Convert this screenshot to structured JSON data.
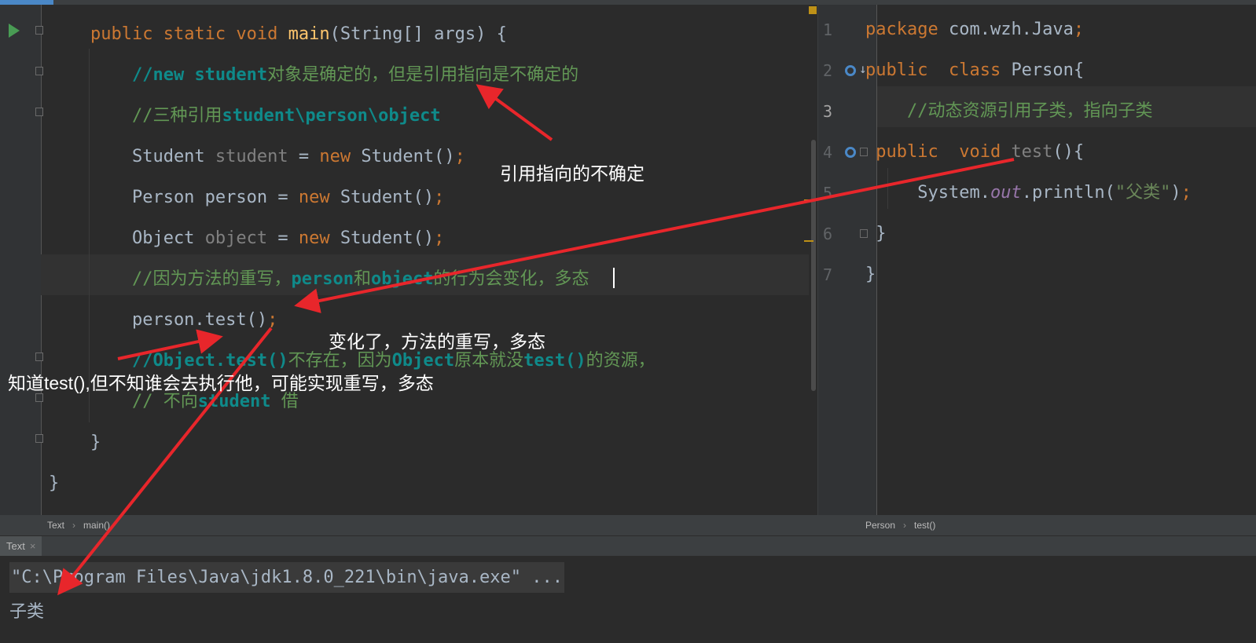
{
  "left_editor": {
    "lines": [
      {
        "parts": [
          [
            "pl",
            "    "
          ],
          [
            "kw",
            "public static void "
          ],
          [
            "fn",
            "main"
          ],
          [
            "pl",
            "(String[] args) {"
          ]
        ]
      },
      {
        "parts": [
          [
            "pl",
            "        "
          ],
          [
            "cmb",
            "//new student"
          ],
          [
            "cm",
            "对象是确定的，但是引用指向是不确定的"
          ]
        ]
      },
      {
        "parts": [
          [
            "pl",
            "        "
          ],
          [
            "cm",
            "//三种引用"
          ],
          [
            "cmb",
            "student\\person\\object"
          ]
        ]
      },
      {
        "parts": [
          [
            "pl",
            "        Student "
          ],
          [
            "gray",
            "student"
          ],
          [
            "pl",
            " = "
          ],
          [
            "kw",
            "new "
          ],
          [
            "pl",
            "Student()"
          ],
          [
            "kw",
            ";"
          ]
        ]
      },
      {
        "parts": [
          [
            "pl",
            "        Person person = "
          ],
          [
            "kw",
            "new "
          ],
          [
            "pl",
            "Student()"
          ],
          [
            "kw",
            ";"
          ]
        ]
      },
      {
        "parts": [
          [
            "pl",
            "        Object "
          ],
          [
            "gray",
            "object"
          ],
          [
            "pl",
            " = "
          ],
          [
            "kw",
            "new "
          ],
          [
            "pl",
            "Student()"
          ],
          [
            "kw",
            ";"
          ]
        ]
      },
      {
        "parts": [
          [
            "pl",
            "        "
          ],
          [
            "cm",
            "//因为方法的重写，"
          ],
          [
            "cmb",
            "person"
          ],
          [
            "cm",
            "和"
          ],
          [
            "cmb",
            "object"
          ],
          [
            "cm",
            "的行为会变化，多态"
          ]
        ]
      },
      {
        "parts": [
          [
            "pl",
            "        person.test()"
          ],
          [
            "kw",
            ";"
          ]
        ]
      },
      {
        "parts": [
          [
            "pl",
            "        "
          ],
          [
            "cmb",
            "//Object.test()"
          ],
          [
            "cm",
            "不存在，因为"
          ],
          [
            "cmb",
            "Object"
          ],
          [
            "cm",
            "原本就没"
          ],
          [
            "cmb",
            "test()"
          ],
          [
            "cm",
            "的资源，"
          ]
        ]
      },
      {
        "parts": [
          [
            "pl",
            "        "
          ],
          [
            "cm",
            "// 不向"
          ],
          [
            "cmb",
            "student "
          ],
          [
            "cm",
            "借"
          ]
        ]
      },
      {
        "parts": [
          [
            "pl",
            "    }"
          ]
        ]
      },
      {
        "parts": [
          [
            "pl",
            "}"
          ]
        ]
      }
    ]
  },
  "right_editor": {
    "line_numbers": [
      "1",
      "2",
      "3",
      "4",
      "5",
      "6",
      "7"
    ],
    "lines": [
      {
        "parts": [
          [
            "kw",
            "package "
          ],
          [
            "pl",
            "com.wzh.Java"
          ],
          [
            "kw",
            ";"
          ]
        ]
      },
      {
        "parts": [
          [
            "kw",
            "public  class "
          ],
          [
            "pl",
            "Person{"
          ]
        ]
      },
      {
        "parts": [
          [
            "pl",
            "    "
          ],
          [
            "cm",
            "//动态资源引用子类，指向子类"
          ]
        ]
      },
      {
        "parts": [
          [
            "pl",
            " "
          ],
          [
            "kw",
            "public  void "
          ],
          [
            "gray",
            "test"
          ],
          [
            "pl",
            "(){"
          ]
        ]
      },
      {
        "parts": [
          [
            "pl",
            "     System."
          ],
          [
            "ital",
            "out"
          ],
          [
            "pl",
            ".println("
          ],
          [
            "str",
            "\"父类\""
          ],
          [
            "pl",
            ")"
          ],
          [
            "kw",
            ";"
          ]
        ]
      },
      {
        "parts": [
          [
            "pl",
            " }"
          ]
        ]
      },
      {
        "parts": [
          [
            "pl",
            "}"
          ]
        ]
      }
    ]
  },
  "breadcrumbs": {
    "left": [
      "Text",
      "main()"
    ],
    "right": [
      "Person",
      "test()"
    ],
    "separator": "›"
  },
  "run_panel": {
    "tab_label": "Text",
    "tab_close": "×",
    "command": "\"C:\\Program Files\\Java\\jdk1.8.0_221\\bin\\java.exe\" ...",
    "output": "子类"
  },
  "annotations": {
    "note1": "引用指向的不确定",
    "note2": "变化了，方法的重写，多态",
    "note3": "知道test(),但不知谁会去执行他，可能实现重写，多态",
    "arrow_color": "#e8262b"
  },
  "colors": {
    "keyword": "#cc7832",
    "function": "#ffc66d",
    "comment": "#629755",
    "doc_comment": "#0f8a8a",
    "plain": "#a9b7c6",
    "string": "#6a8759",
    "background": "#2b2b2b"
  }
}
